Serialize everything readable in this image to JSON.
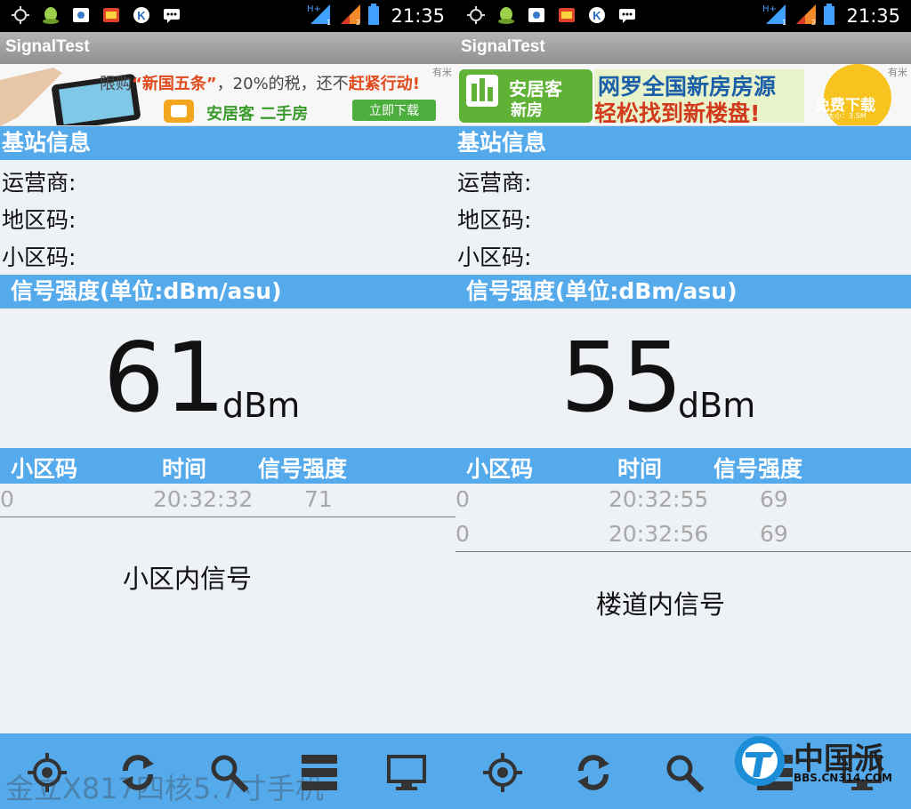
{
  "status_bar": {
    "time": "21:35",
    "network_label": "H+"
  },
  "colors": {
    "accent": "#55aaec",
    "title_bar": "#a3a3a3",
    "background": "#eef1f5"
  },
  "screens": [
    {
      "app_title": "SignalTest",
      "ad": {
        "tag": "有米",
        "headline_pre": "限购",
        "headline_quote": "“新国五条”",
        "headline_mid": "，20%的税，还不",
        "headline_bold": "赶紧行动",
        "headline_end": "!",
        "brand": "安居客 二手房",
        "cta": "立即下载"
      },
      "base_station_header": "基站信息",
      "operator_label": "运营商:",
      "area_code_label": "地区码:",
      "cell_code_label": "小区码:",
      "signal_header": "信号强度(单位:dBm/asu)",
      "signal_value": "61",
      "signal_unit": "dBm",
      "table": {
        "col_cell": "小区码",
        "col_time": "时间",
        "col_strength": "信号强度",
        "rows": [
          {
            "cell": "0",
            "time": "20:32:32",
            "strength": "71"
          }
        ]
      },
      "caption": "小区内信号"
    },
    {
      "app_title": "SignalTest",
      "ad": {
        "tag": "有米",
        "brand_line1": "安居客",
        "brand_line2": "新房",
        "headline_line1": "网罗全国新房房源",
        "headline_line2": "轻松找到新楼盘!",
        "cta": "免费下载",
        "size": "大小：3.5M"
      },
      "base_station_header": "基站信息",
      "operator_label": "运营商:",
      "area_code_label": "地区码:",
      "cell_code_label": "小区码:",
      "signal_header": "信号强度(单位:dBm/asu)",
      "signal_value": "55",
      "signal_unit": "dBm",
      "table": {
        "col_cell": "小区码",
        "col_time": "时间",
        "col_strength": "信号强度",
        "rows": [
          {
            "cell": "0",
            "time": "20:32:55",
            "strength": "69"
          },
          {
            "cell": "0",
            "time": "20:32:56",
            "strength": "69"
          }
        ]
      },
      "caption": "楼道内信号"
    }
  ],
  "nav_icons": [
    "locate-icon",
    "refresh-icon",
    "search-icon",
    "list-icon",
    "monitor-icon"
  ],
  "watermark": {
    "text": "金立X817四核5.7寸手机",
    "logo_text": "中国派",
    "logo_url": "BBS.CN314.COM"
  }
}
